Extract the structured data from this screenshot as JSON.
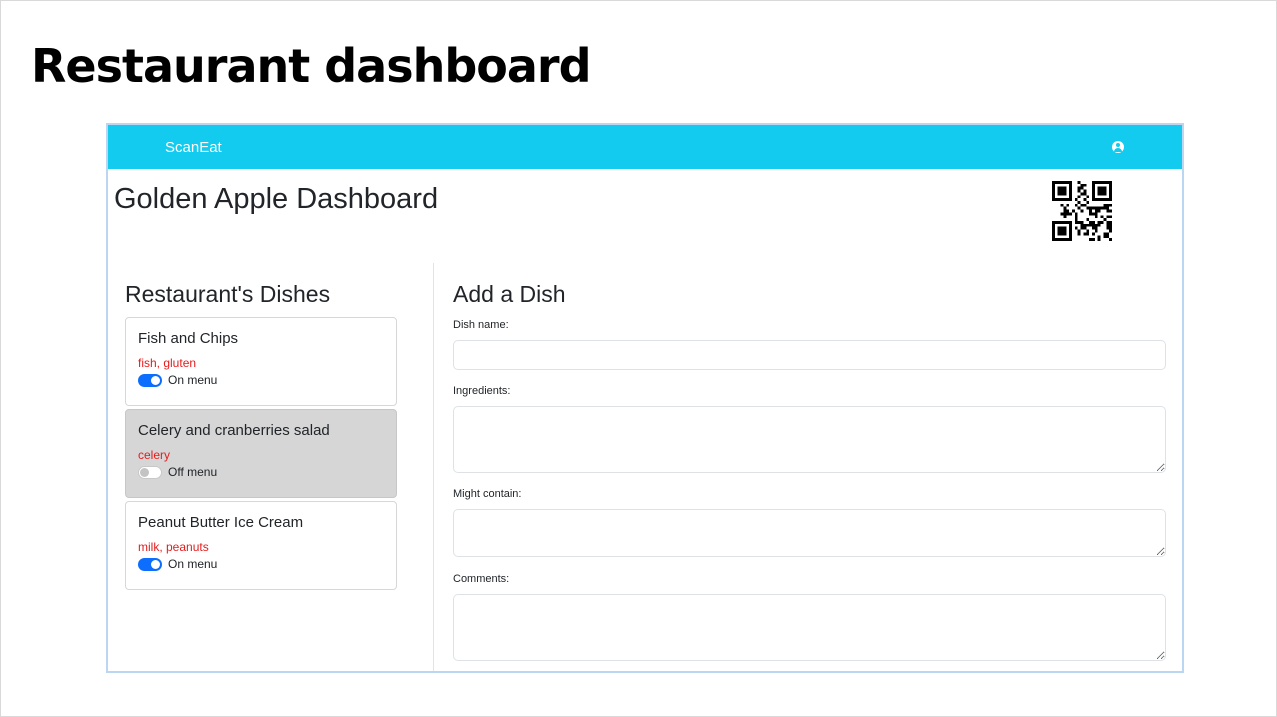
{
  "slide": {
    "title": "Restaurant dashboard"
  },
  "navbar": {
    "brand": "ScanEat",
    "user_icon": "user-circle-icon",
    "color": "#12cbef"
  },
  "dashboard": {
    "title": "Golden Apple Dashboard",
    "qr_icon": "qr-code-icon"
  },
  "dishes": {
    "heading": "Restaurant's Dishes",
    "items": [
      {
        "name": "Fish and Chips",
        "allergens": "fish, gluten",
        "status": "On menu",
        "on_menu": true
      },
      {
        "name": "Celery and cranberries salad",
        "allergens": "celery",
        "status": "Off menu",
        "on_menu": false
      },
      {
        "name": "Peanut Butter Ice Cream",
        "allergens": "milk, peanuts",
        "status": "On menu",
        "on_menu": true
      }
    ]
  },
  "add_dish": {
    "heading": "Add a Dish",
    "fields": {
      "name": {
        "label": "Dish name:",
        "value": "",
        "placeholder": ""
      },
      "ingredients": {
        "label": "Ingredients:",
        "value": "",
        "placeholder": ""
      },
      "might_contain": {
        "label": "Might contain:",
        "value": "",
        "placeholder": ""
      },
      "comments": {
        "label": "Comments:",
        "value": "",
        "placeholder": ""
      }
    }
  },
  "colors": {
    "accent": "#12cbef",
    "allergen_text": "#e51c1c",
    "toggle_on": "#0d6efd",
    "off_menu_card": "#d6d6d6"
  }
}
